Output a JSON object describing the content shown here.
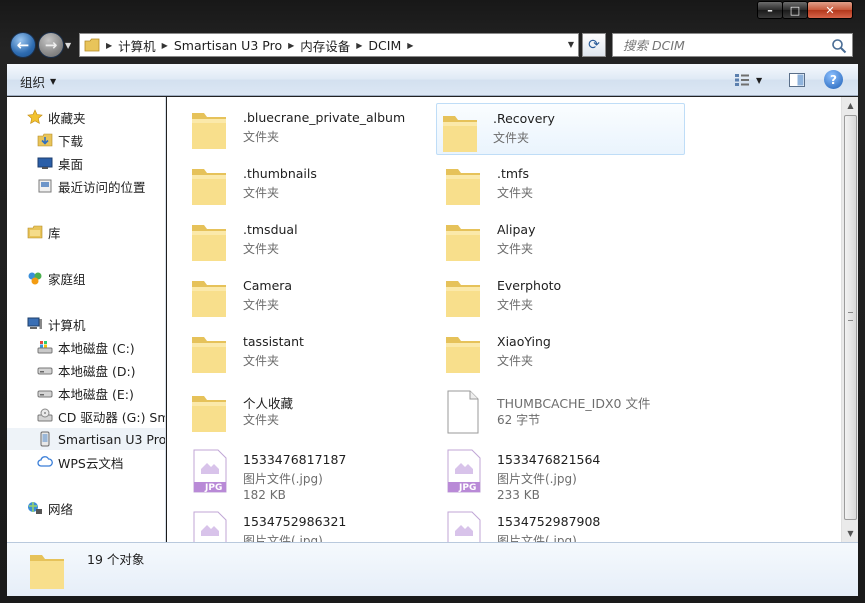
{
  "window": {
    "controls": {
      "minimize": "–",
      "maximize": "□",
      "close": "✕"
    }
  },
  "navigation": {
    "back": "←",
    "forward": "→",
    "breadcrumb": [
      "计算机",
      "Smartisan U3 Pro",
      "内存设备",
      "DCIM"
    ],
    "refresh": "⟳",
    "search_placeholder": "搜索 DCIM"
  },
  "toolbar": {
    "organize": "组织",
    "help": "?"
  },
  "sidebar": {
    "items": [
      {
        "label": "收藏夹",
        "icon": "star-icon"
      },
      {
        "label": "下载",
        "icon": "download-folder-icon"
      },
      {
        "label": "桌面",
        "icon": "desktop-icon"
      },
      {
        "label": "最近访问的位置",
        "icon": "recent-places-icon"
      },
      {
        "label": "库",
        "icon": "library-icon"
      },
      {
        "label": "家庭组",
        "icon": "homegroup-icon"
      },
      {
        "label": "计算机",
        "icon": "computer-icon"
      },
      {
        "label": "本地磁盘 (C:)",
        "icon": "windows-drive-icon"
      },
      {
        "label": "本地磁盘 (D:)",
        "icon": "drive-icon"
      },
      {
        "label": "本地磁盘 (E:)",
        "icon": "drive-icon"
      },
      {
        "label": "CD 驱动器 (G:) Sma",
        "icon": "cd-drive-icon"
      },
      {
        "label": "Smartisan U3 Pro",
        "icon": "phone-icon"
      },
      {
        "label": "WPS云文档",
        "icon": "cloud-icon"
      },
      {
        "label": "网络",
        "icon": "network-icon"
      }
    ]
  },
  "files": [
    {
      "name": ".bluecrane_private_album",
      "type": "文件夹",
      "kind": "folder"
    },
    {
      "name": ".Recovery",
      "type": "文件夹",
      "kind": "folder"
    },
    {
      "name": ".thumbnails",
      "type": "文件夹",
      "kind": "folder"
    },
    {
      "name": ".tmfs",
      "type": "文件夹",
      "kind": "folder"
    },
    {
      "name": ".tmsdual",
      "type": "文件夹",
      "kind": "folder"
    },
    {
      "name": "Alipay",
      "type": "文件夹",
      "kind": "folder"
    },
    {
      "name": "Camera",
      "type": "文件夹",
      "kind": "folder"
    },
    {
      "name": "Everphoto",
      "type": "文件夹",
      "kind": "folder"
    },
    {
      "name": "tassistant",
      "type": "文件夹",
      "kind": "folder"
    },
    {
      "name": "XiaoYing",
      "type": "文件夹",
      "kind": "folder"
    },
    {
      "name": "个人收藏",
      "type": "文件夹",
      "kind": "folder"
    },
    {
      "name": "THUMBCACHE_IDX0 文件",
      "type": "62 字节",
      "kind": "file"
    },
    {
      "name": "1533476817187",
      "type": "图片文件(.jpg)",
      "size": "182 KB",
      "kind": "jpg"
    },
    {
      "name": "1533476821564",
      "type": "图片文件(.jpg)",
      "size": "233 KB",
      "kind": "jpg"
    },
    {
      "name": "1534752986321",
      "type": "图片文件(.jpg)",
      "kind": "jpg"
    },
    {
      "name": "1534752987908",
      "type": "图片文件(.jpg)",
      "kind": "jpg"
    }
  ],
  "jpg_badge": "JPG",
  "details": {
    "count": "19 个对象"
  }
}
